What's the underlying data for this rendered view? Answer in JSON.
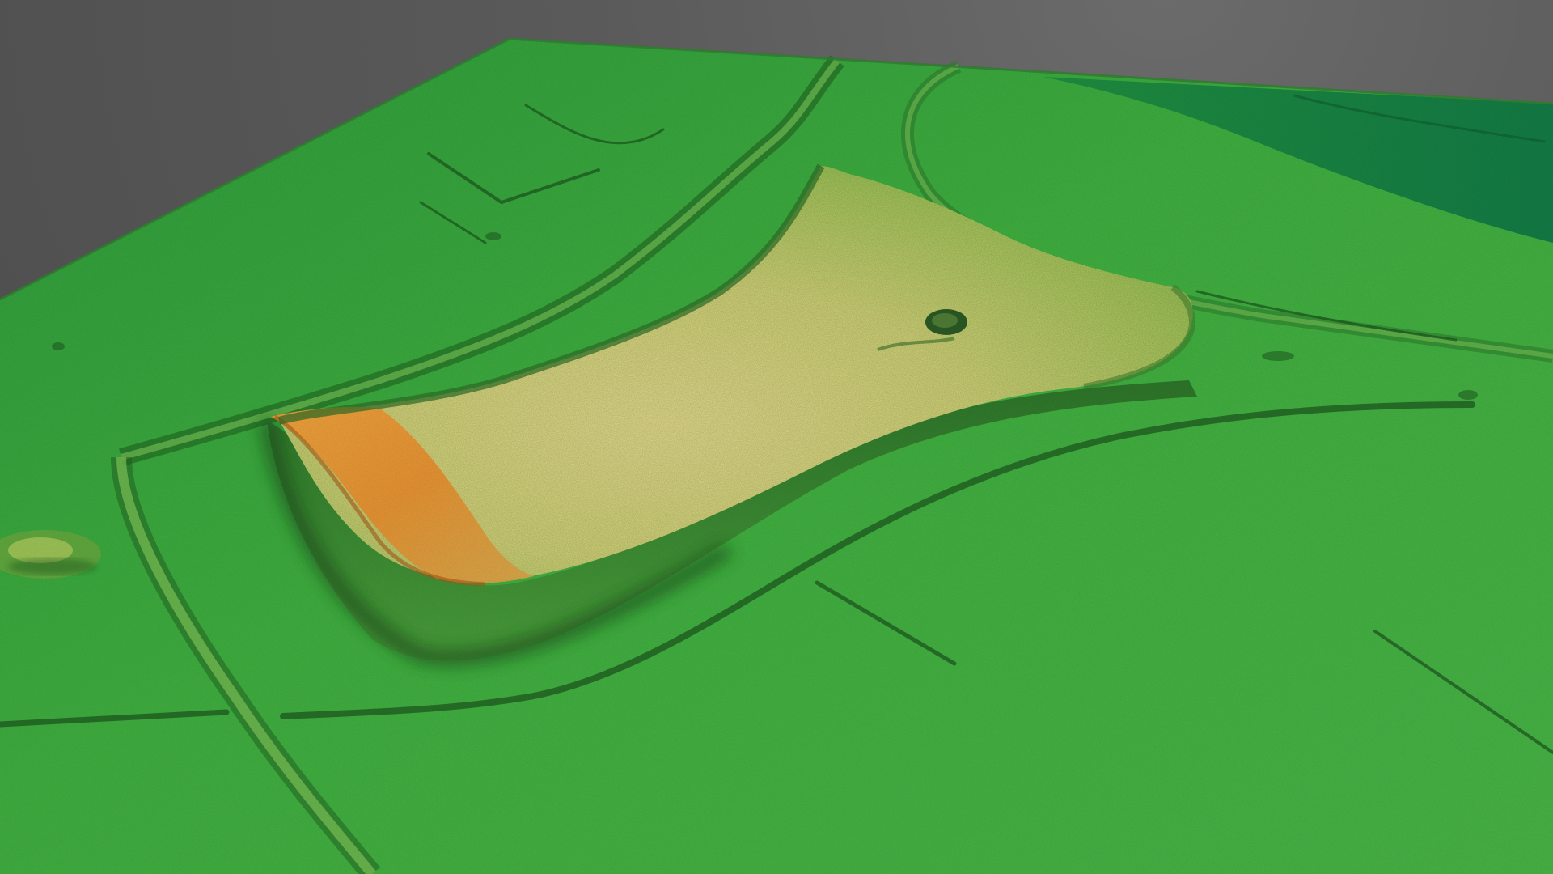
{
  "scene": {
    "kind": "3d-lidar-terrain-hillshade",
    "features": [
      "terrain-surface",
      "hillfort-plateau",
      "pond-depression",
      "sunken-road-north",
      "road-west",
      "road-curve-east",
      "field-boundaries",
      "river-channel",
      "small-mound-west"
    ]
  },
  "colors": {
    "background": "#5a5a5a",
    "lowland_dark_green": "#1f8f3c",
    "lowland_green": "#3fae3f",
    "midland_green": "#7cc04a",
    "upland_yellow_green": "#c7d46a",
    "summit_yellow": "#e3dc8a",
    "summit_orange": "#e7902f",
    "ridge_shadow": "#1e5a1e",
    "river_green": "#1a8a4a"
  }
}
